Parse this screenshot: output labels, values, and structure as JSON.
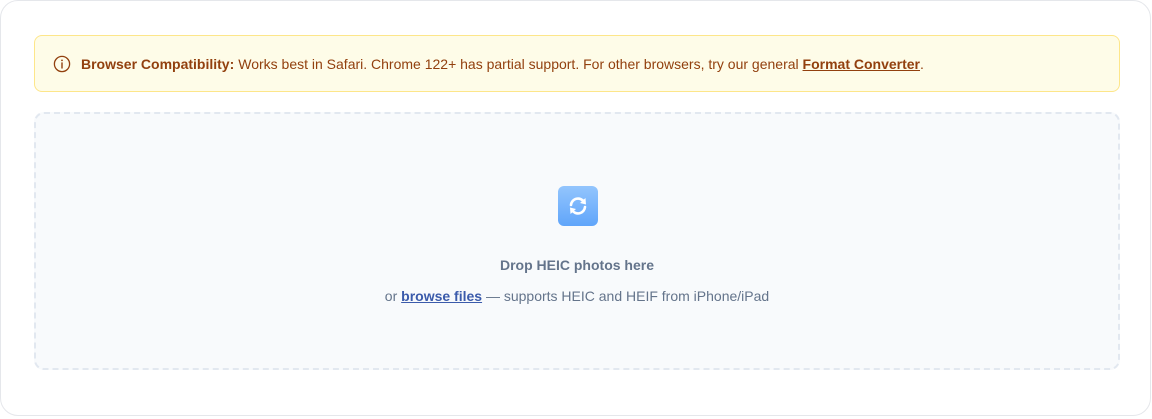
{
  "alert": {
    "icon": "info-circle-icon",
    "title": "Browser Compatibility:",
    "message": "Works best in Safari. Chrome 122+ has partial support. For other browsers, try our general",
    "link_label": "Format Converter",
    "suffix": ".",
    "colors": {
      "background": "#fefce8",
      "border": "#fde68a",
      "text": "#92400e"
    }
  },
  "dropzone": {
    "icon": "convert-arrows-icon",
    "title": "Drop HEIC photos here",
    "prefix": "or",
    "browse_label": "browse files",
    "suffix": "— supports HEIC and HEIF from iPhone/iPad",
    "colors": {
      "background": "#f8fafc",
      "border": "#e2e8f0",
      "link": "#3b5bab"
    }
  }
}
